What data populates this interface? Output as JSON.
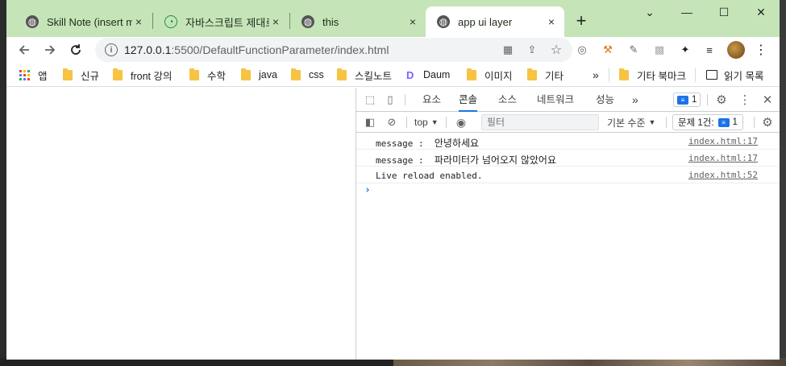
{
  "tabs": [
    {
      "title": "Skill Note (insert m",
      "favicon": "globe-icon",
      "active": false
    },
    {
      "title": "자바스크립트 제대로",
      "favicon": "green-circle-icon",
      "active": false
    },
    {
      "title": "this",
      "favicon": "globe-icon",
      "active": false
    },
    {
      "title": "app ui layer",
      "favicon": "globe-icon",
      "active": true
    }
  ],
  "tab_close_glyph": "×",
  "new_tab_glyph": "+",
  "window_controls": {
    "collapse": "⌄",
    "minimize": "—",
    "maximize": "☐",
    "close": "✕"
  },
  "address_bar": {
    "host": "127.0.0.1",
    "path": ":5500/DefaultFunctionParameter/index.html"
  },
  "bookmarks": [
    {
      "label": "앱",
      "type": "apps"
    },
    {
      "label": "신규",
      "type": "folder"
    },
    {
      "label": "front 강의",
      "type": "folder"
    },
    {
      "label": "수학",
      "type": "folder"
    },
    {
      "label": "java",
      "type": "folder"
    },
    {
      "label": "css",
      "type": "folder"
    },
    {
      "label": "스킬노트",
      "type": "folder"
    },
    {
      "label": "Daum",
      "type": "site"
    },
    {
      "label": "이미지",
      "type": "folder"
    },
    {
      "label": "기타",
      "type": "folder"
    }
  ],
  "bookmarks_overflow": "»",
  "bookmarks_other": "기타 북마크",
  "reading_list": "읽기 목록",
  "devtools": {
    "tabs": [
      "요소",
      "콘솔",
      "소스",
      "네트워크",
      "성능"
    ],
    "active_tab": "콘솔",
    "more_tabs": "»",
    "message_badge": "1",
    "context": "top",
    "filter_placeholder": "필터",
    "level": "기본 수준",
    "issues_label": "문제 1건:",
    "issues_count": "1",
    "logs": [
      {
        "text": "message :  ",
        "kr": "안녕하세요",
        "source": "index.html:17"
      },
      {
        "text": "message :  ",
        "kr": "파라미터가 넘어오지 않았어요",
        "source": "index.html:17"
      },
      {
        "text": "Live reload enabled.",
        "kr": "",
        "source": "index.html:52"
      }
    ],
    "prompt": "›"
  },
  "colors": {
    "tabstrip": "#c5e5b8",
    "accent": "#1a73e8"
  }
}
